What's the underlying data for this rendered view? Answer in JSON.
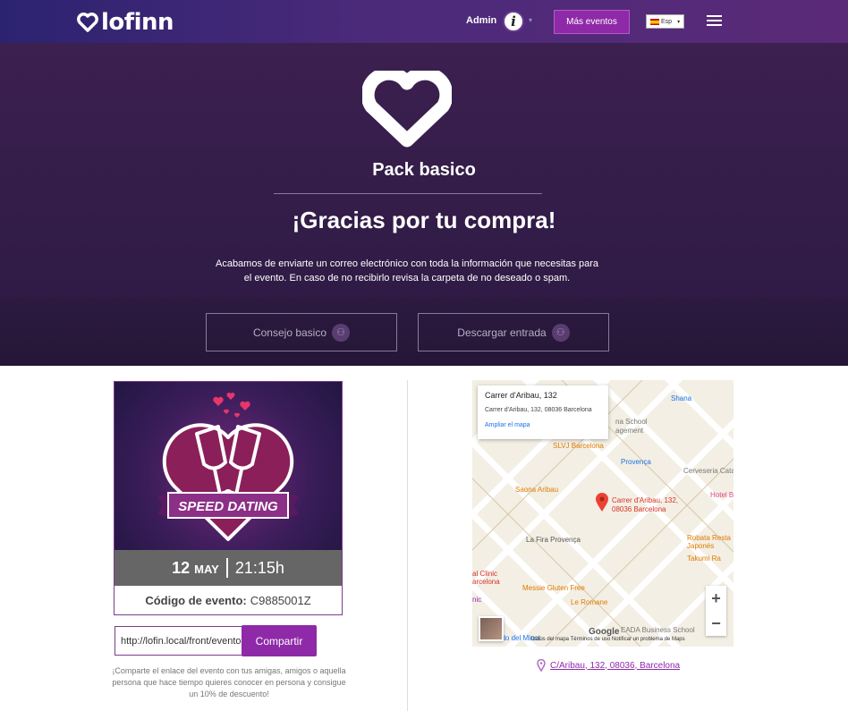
{
  "nav": {
    "logo_text": "lofinn",
    "admin_label": "Admin",
    "more_events_label": "Más eventos",
    "language": "Esp",
    "brand_color": "#8e2aa8"
  },
  "hero": {
    "pack_title": "Pack basico",
    "thanks_title": "¡Gracias por tu compra!",
    "message": "Acabamos de enviarte un correo electrónico con toda la información que necesitas para el evento. En caso de no recibirlo revisa la carpeta de no deseado o spam."
  },
  "actions": {
    "advice_label": "Consejo basico",
    "download_label": "Descargar entrada"
  },
  "event": {
    "image_text": "SPEED DATING",
    "day": "12",
    "month": "MAY",
    "time": "21:15h",
    "code_label": "Código de evento:",
    "code_value": "C9885001Z"
  },
  "share": {
    "url_value": "http://lofin.local/front/eventos/",
    "button_label": "Compartir",
    "note": "¡Comparte el enlace del evento con tus amigas, amigos o aquella persona que hace tiempo quieres conocer en persona y consigue un 10% de descuento!"
  },
  "map": {
    "popup_title": "Carrer d'Aribau, 132",
    "popup_address": "Carrer d'Aribau, 132, 08036 Barcelona",
    "popup_link": "Ampliar el mapa",
    "marker_label_1": "Carrer d'Aribau, 132,",
    "marker_label_2": "08036 Barcelona",
    "pois": {
      "shana": "Shana",
      "school_1": "na School",
      "school_2": "agement",
      "slvj": "SLVJ Barcelona",
      "provenca": "Provença",
      "cerveseria": "Cerveseria Catalan",
      "saona": "Saona Aribau",
      "hotel": "Hotel B",
      "lafira": "La Fira Provença",
      "robata_1": "Robata Resta",
      "robata_2": "Japonés",
      "takumi": "Takumi Ra",
      "clinic_1": "al Clinic",
      "clinic_2": "arcelona",
      "messie": "Messie Gluten Free",
      "leromane": "Le Romane",
      "nic": "nic",
      "eada": "EADA Business School",
      "minot": "ado del Minot"
    },
    "zoom_in": "+",
    "zoom_out": "−",
    "google": "Google",
    "footer": "Datos del mapa   Términos de uso   Notificar un problema de Maps",
    "address_link": "C/Aribau, 132, 08036, Barcelona"
  }
}
